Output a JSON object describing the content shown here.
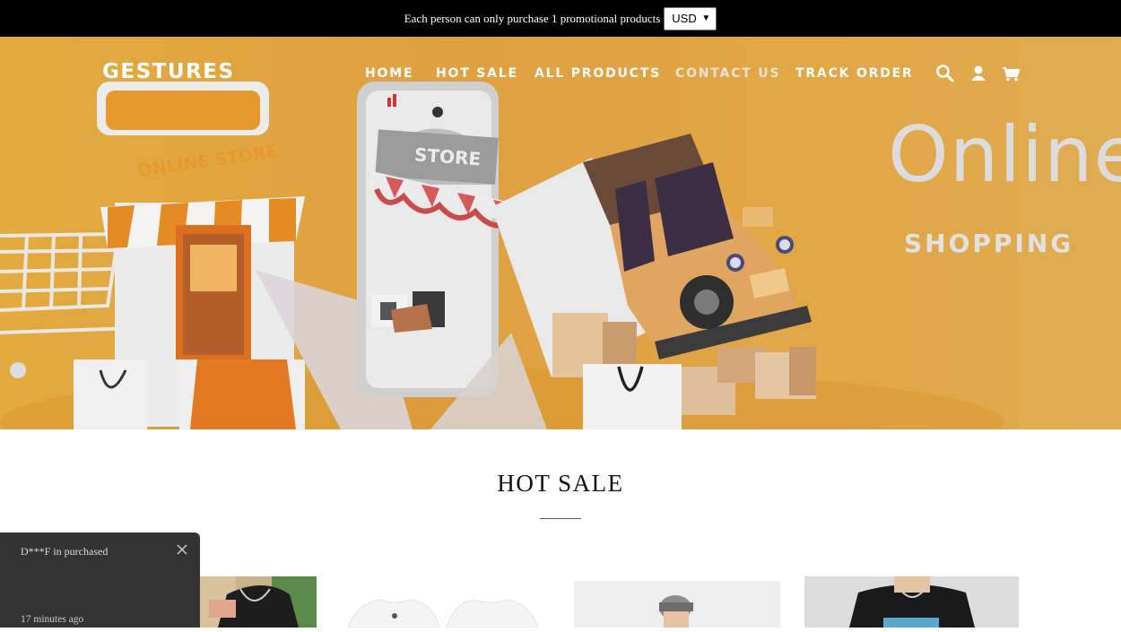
{
  "announcement": {
    "text": "Each person can only purchase 1 promotional products",
    "currency": "USD"
  },
  "header": {
    "logo": "GESTURES",
    "nav": [
      "HOME",
      "HOT SALE",
      "ALL PRODUCTS",
      "CONTACT US",
      "TRACK ORDER"
    ],
    "active_nav": "CONTACT US",
    "icons": [
      "search-icon",
      "account-icon",
      "cart-icon"
    ]
  },
  "hero": {
    "store_sign": "ONLINE STORE",
    "phone_sign": "STORE",
    "headline": "Online",
    "subheadline": "SHOPPING"
  },
  "section": {
    "title": "HOT SALE"
  },
  "popup": {
    "message": "D***F in purchased",
    "time": "17 minutes ago"
  },
  "colors": {
    "hero_bg": "#e1a645",
    "announce_bg": "#000000",
    "popup_bg": "#333333"
  }
}
